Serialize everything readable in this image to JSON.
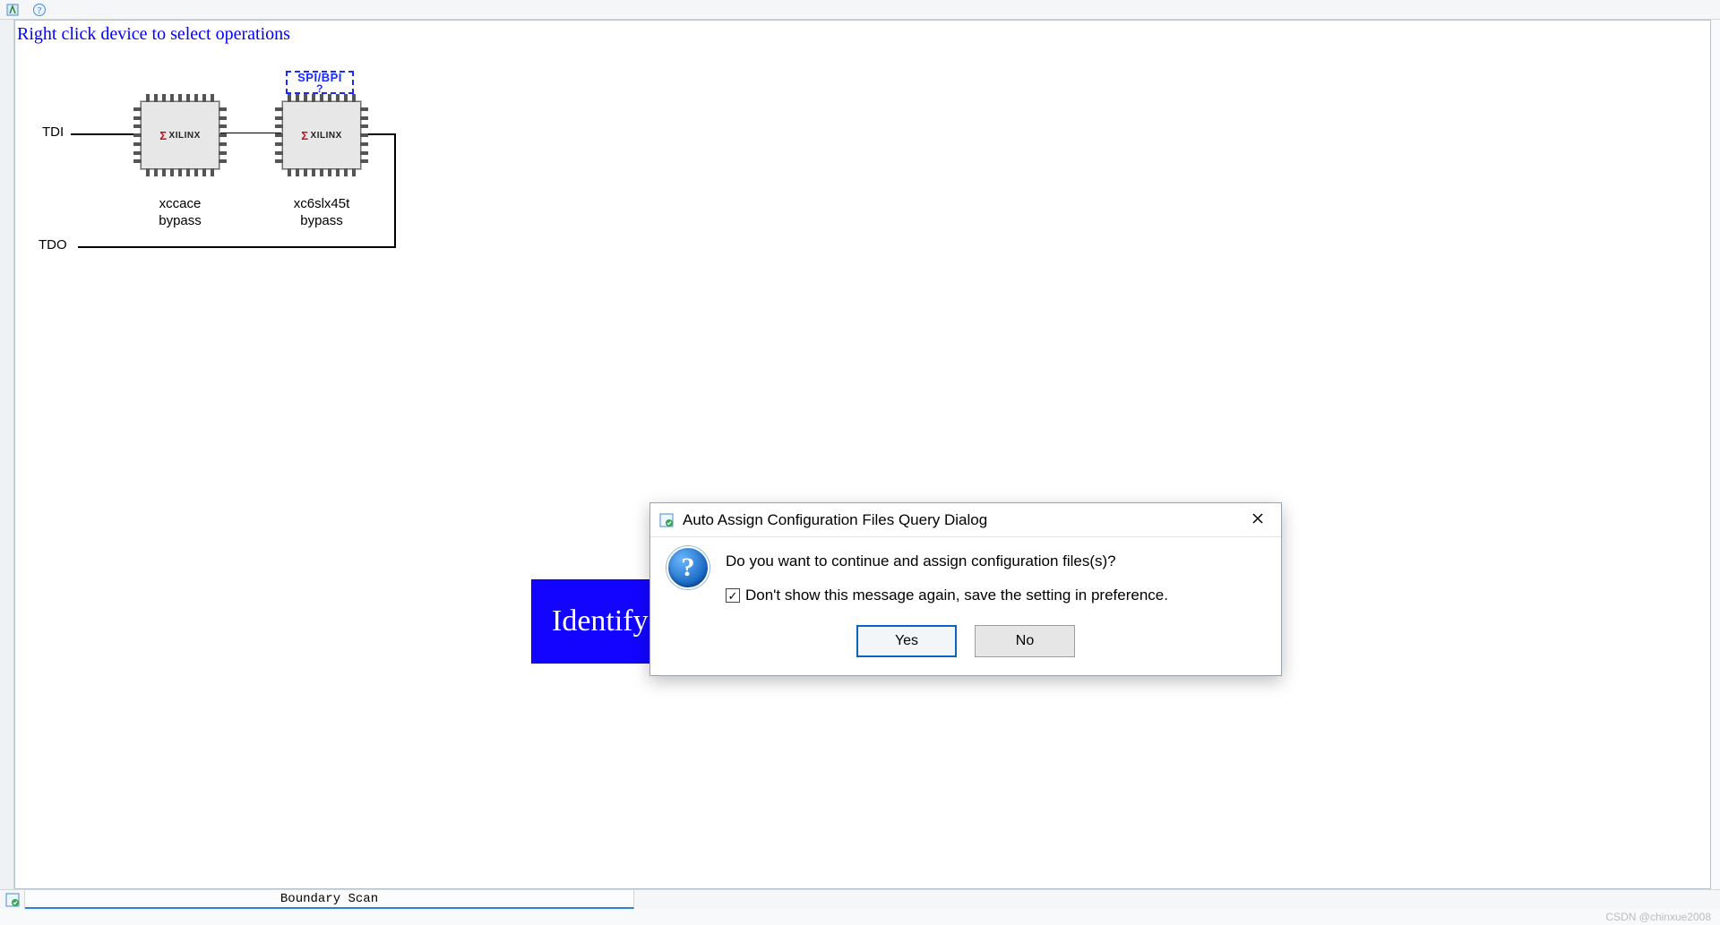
{
  "toolbar": {
    "icon1": "app-icon",
    "icon2": "help-icon"
  },
  "canvas": {
    "hint": "Right click device to select operations",
    "tdi_label": "TDI",
    "tdo_label": "TDO",
    "spi_bpi_label": "SPI/BPI",
    "spi_bpi_sub": "?",
    "chip_logo_text": "XILINX",
    "devices": [
      {
        "name": "xccace",
        "mode": "bypass"
      },
      {
        "name": "xc6slx45t",
        "mode": "bypass"
      }
    ]
  },
  "identify_banner": "Identify",
  "dialog": {
    "title": "Auto Assign Configuration Files Query Dialog",
    "icon_char": "?",
    "message": "Do you want to continue and assign configuration files(s)?",
    "checkbox_label": "Don't show this message again, save the setting in preference.",
    "checkbox_checked": true,
    "yes_label": "Yes",
    "no_label": "No"
  },
  "tabbar": {
    "active_tab": "Boundary Scan"
  },
  "watermark": "CSDN @chinxue2008"
}
